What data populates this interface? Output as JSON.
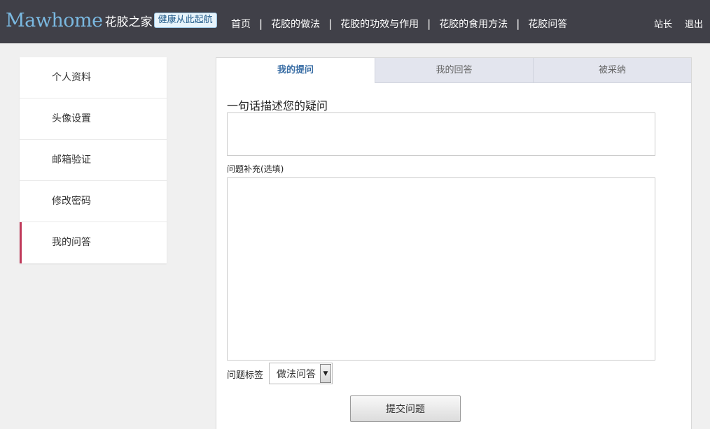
{
  "header": {
    "logo_en": "Mawhome",
    "logo_cn": "花胶之家",
    "slogan": "健康从此起航",
    "nav": [
      "首页",
      "花胶的做法",
      "花胶的功效与作用",
      "花胶的食用方法",
      "花胶问答"
    ],
    "nav_separator": "|",
    "user_links": [
      "站长",
      "退出"
    ]
  },
  "sidebar": {
    "items": [
      {
        "label": "个人资料"
      },
      {
        "label": "头像设置"
      },
      {
        "label": "邮箱验证"
      },
      {
        "label": "修改密码"
      },
      {
        "label": "我的问答",
        "active": true
      }
    ]
  },
  "tabs": [
    {
      "label": "我的提问",
      "active": true
    },
    {
      "label": "我的回答"
    },
    {
      "label": "被采纳"
    }
  ],
  "form": {
    "title_label": "一句话描述您的疑问",
    "title_value": "",
    "desc_label": "问题补充(选填)",
    "desc_value": "",
    "tag_label": "问题标签",
    "tag_selected": "做法问答",
    "submit_label": "提交问题"
  },
  "colors": {
    "header_bg": "#404048",
    "active_tab_text": "#3a6ea5",
    "active_sidebar_accent": "#c0395a"
  }
}
